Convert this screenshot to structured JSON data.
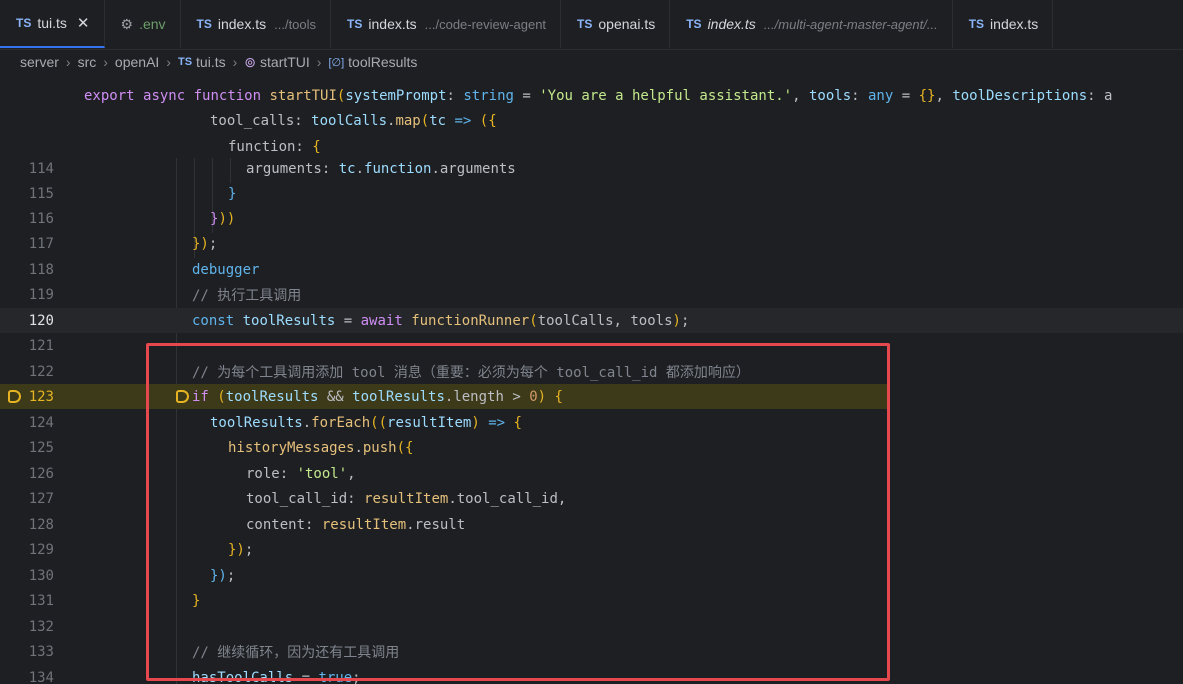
{
  "tabs": [
    {
      "label": "tui.ts",
      "icon": "TS",
      "hint": "",
      "active": true
    },
    {
      "label": ".env",
      "icon": "gear-icon",
      "hint": ""
    },
    {
      "label": "index.ts",
      "icon": "TS",
      "hint": ".../tools"
    },
    {
      "label": "index.ts",
      "icon": "TS",
      "hint": ".../code-review-agent"
    },
    {
      "label": "openai.ts",
      "icon": "TS",
      "hint": ""
    },
    {
      "label": "index.ts",
      "icon": "TS",
      "hint": ".../multi-agent-master-agent/..."
    },
    {
      "label": "index.ts",
      "icon": "TS",
      "hint": ""
    }
  ],
  "breadcrumb": [
    "server",
    "src",
    "openAI",
    "tui.ts",
    "startTUI",
    "toolResults"
  ],
  "sticky": [
    "export async function startTUI(systemPrompt: string = 'You are a helpful assistant.', tools: any = {}, toolDescriptions: a",
    "tool_calls: toolCalls.map(tc => ({",
    "function: {"
  ],
  "lines": [
    {
      "n": "114",
      "text": "arguments: tc.function.arguments"
    },
    {
      "n": "115",
      "text": "}"
    },
    {
      "n": "116",
      "text": "}))"
    },
    {
      "n": "117",
      "text": "});"
    },
    {
      "n": "118",
      "text": "debugger"
    },
    {
      "n": "119",
      "text": "// 执行工具调用"
    },
    {
      "n": "120",
      "text": "const toolResults = await functionRunner(toolCalls, tools);"
    },
    {
      "n": "121",
      "text": ""
    },
    {
      "n": "122",
      "text": "// 为每个工具调用添加 tool 消息（重要：必须为每个 tool_call_id 都添加响应）"
    },
    {
      "n": "123",
      "text": "if (toolResults && toolResults.length > 0) {"
    },
    {
      "n": "124",
      "text": "toolResults.forEach((resultItem) => {"
    },
    {
      "n": "125",
      "text": "historyMessages.push({"
    },
    {
      "n": "126",
      "text": "role: 'tool',"
    },
    {
      "n": "127",
      "text": "tool_call_id: resultItem.tool_call_id,"
    },
    {
      "n": "128",
      "text": "content: resultItem.result"
    },
    {
      "n": "129",
      "text": "});"
    },
    {
      "n": "130",
      "text": "});"
    },
    {
      "n": "131",
      "text": "}"
    },
    {
      "n": "132",
      "text": ""
    },
    {
      "n": "133",
      "text": "// 继续循环，因为还有工具调用"
    },
    {
      "n": "134",
      "text": "hasToolCalls = true;"
    }
  ],
  "colors": {
    "accent": "#3574f0",
    "highlight_box": "#e5484d",
    "debug_line": "#3d3a1a"
  }
}
